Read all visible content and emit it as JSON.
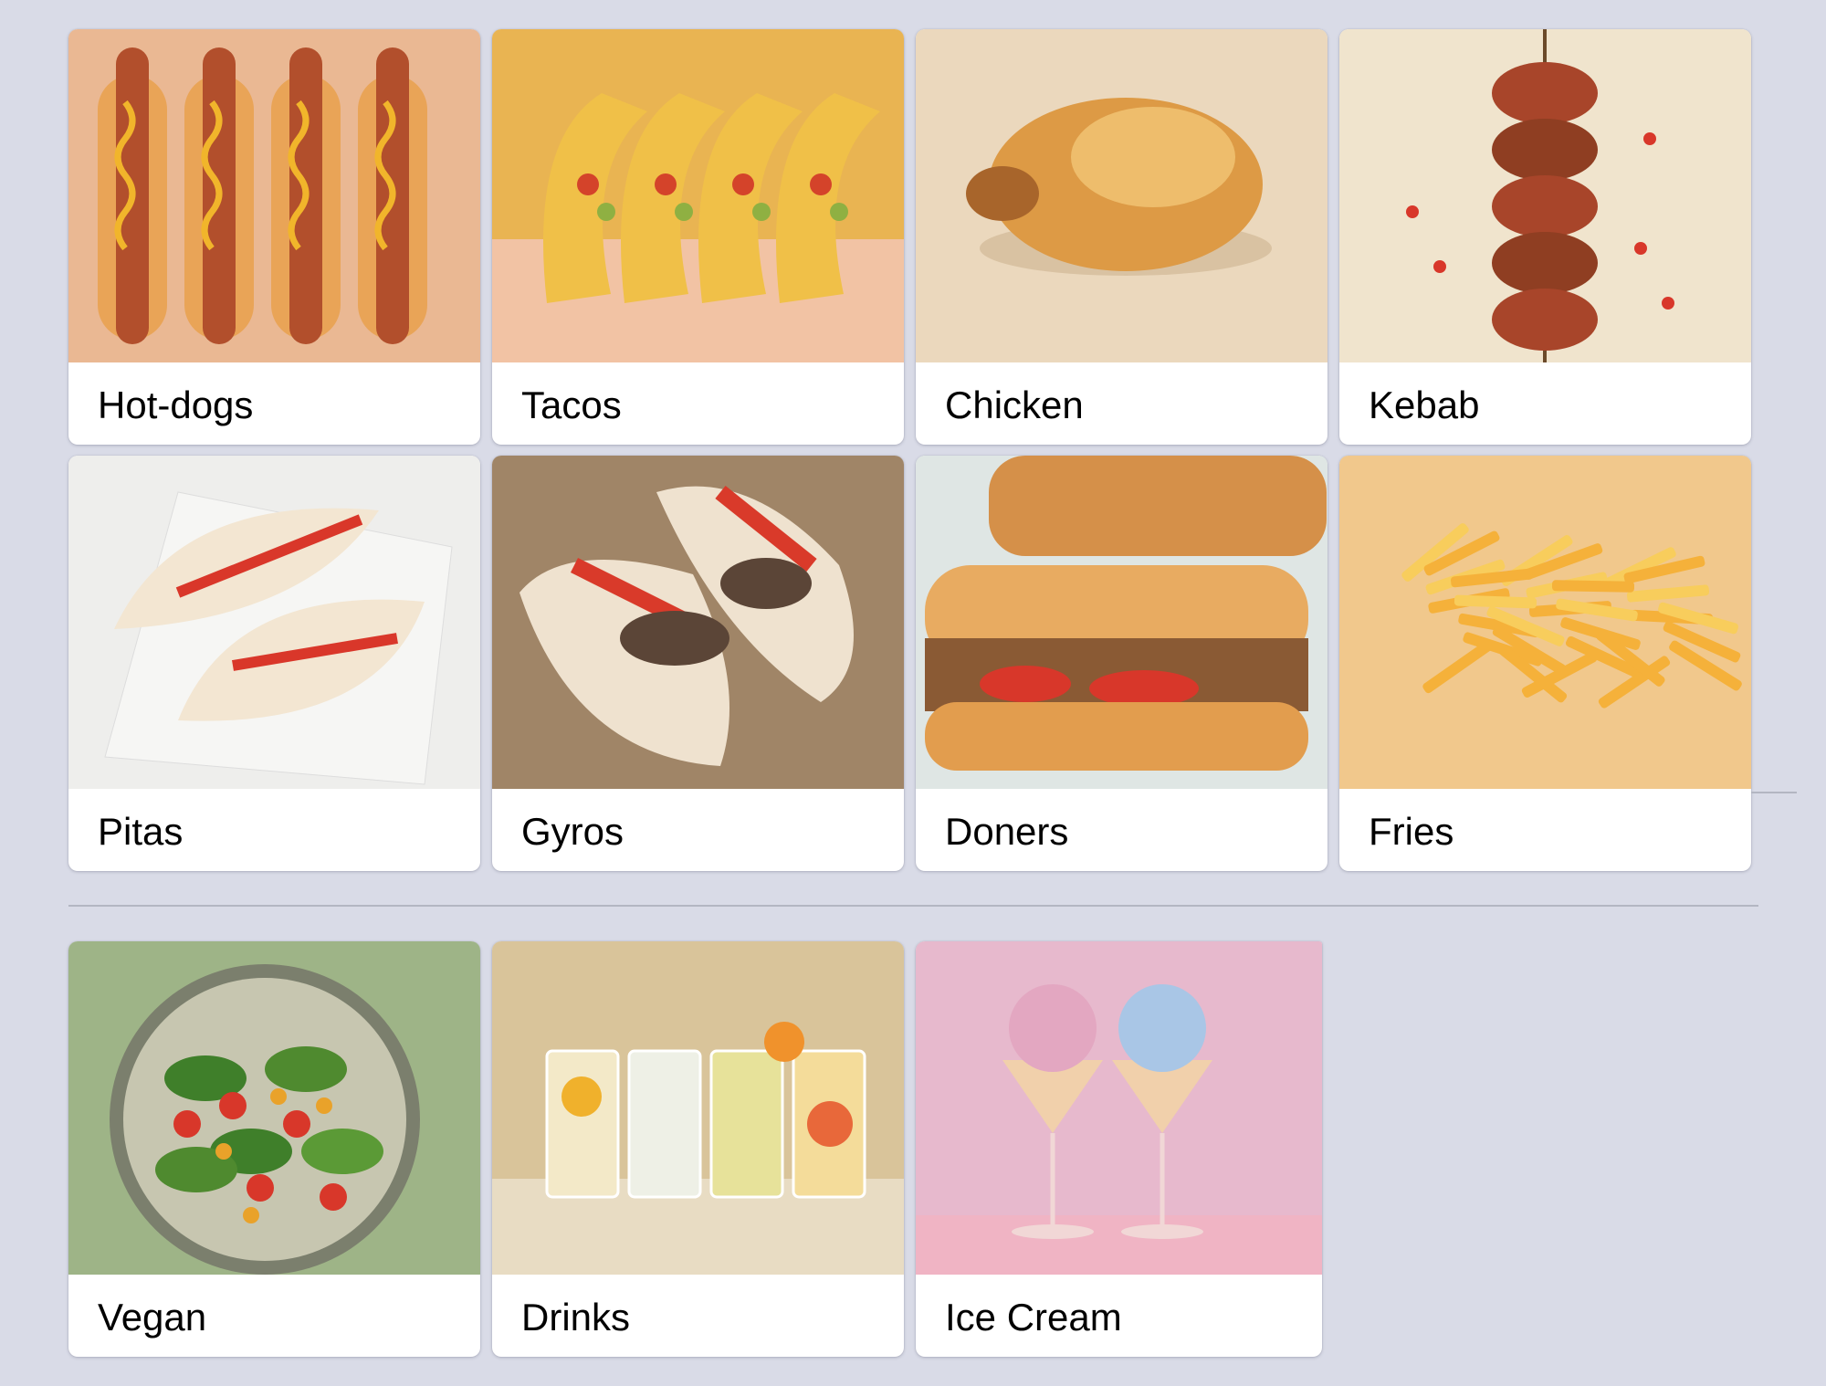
{
  "categories": [
    {
      "label": "Hot-dogs",
      "image": "hot-dogs-photo",
      "bg": "#eab893",
      "accent": "#c0552a"
    },
    {
      "label": "Tacos",
      "image": "tacos-photo",
      "bg": "#e9b452",
      "accent": "#d4432a"
    },
    {
      "label": "Chicken",
      "image": "chicken-photo",
      "bg": "#ebd8bd",
      "accent": "#c97a2e"
    },
    {
      "label": "Kebab",
      "image": "kebab-photo",
      "bg": "#f0e4cd",
      "accent": "#a8452a"
    },
    {
      "label": "Pitas",
      "image": "pitas-photo",
      "bg": "#eeeeec",
      "accent": "#d9372a"
    },
    {
      "label": "Gyros",
      "image": "gyros-photo",
      "bg": "#a08567",
      "accent": "#d93a2a"
    },
    {
      "label": "Doners",
      "image": "doners-photo",
      "bg": "#dfe6e4",
      "accent": "#b66a32"
    },
    {
      "label": "Fries",
      "image": "fries-photo",
      "bg": "#f1c88c",
      "accent": "#f2a82a"
    },
    {
      "label": "Vegan",
      "image": "vegan-photo",
      "bg": "#9eb487",
      "accent": "#4f8a2f"
    },
    {
      "label": "Drinks",
      "image": "drinks-photo",
      "bg": "#d9c49a",
      "accent": "#f0b12c"
    },
    {
      "label": "Ice Cream",
      "image": "ice-cream-photo",
      "bg": "#e7b9cd",
      "accent": "#a9c6e6"
    }
  ]
}
